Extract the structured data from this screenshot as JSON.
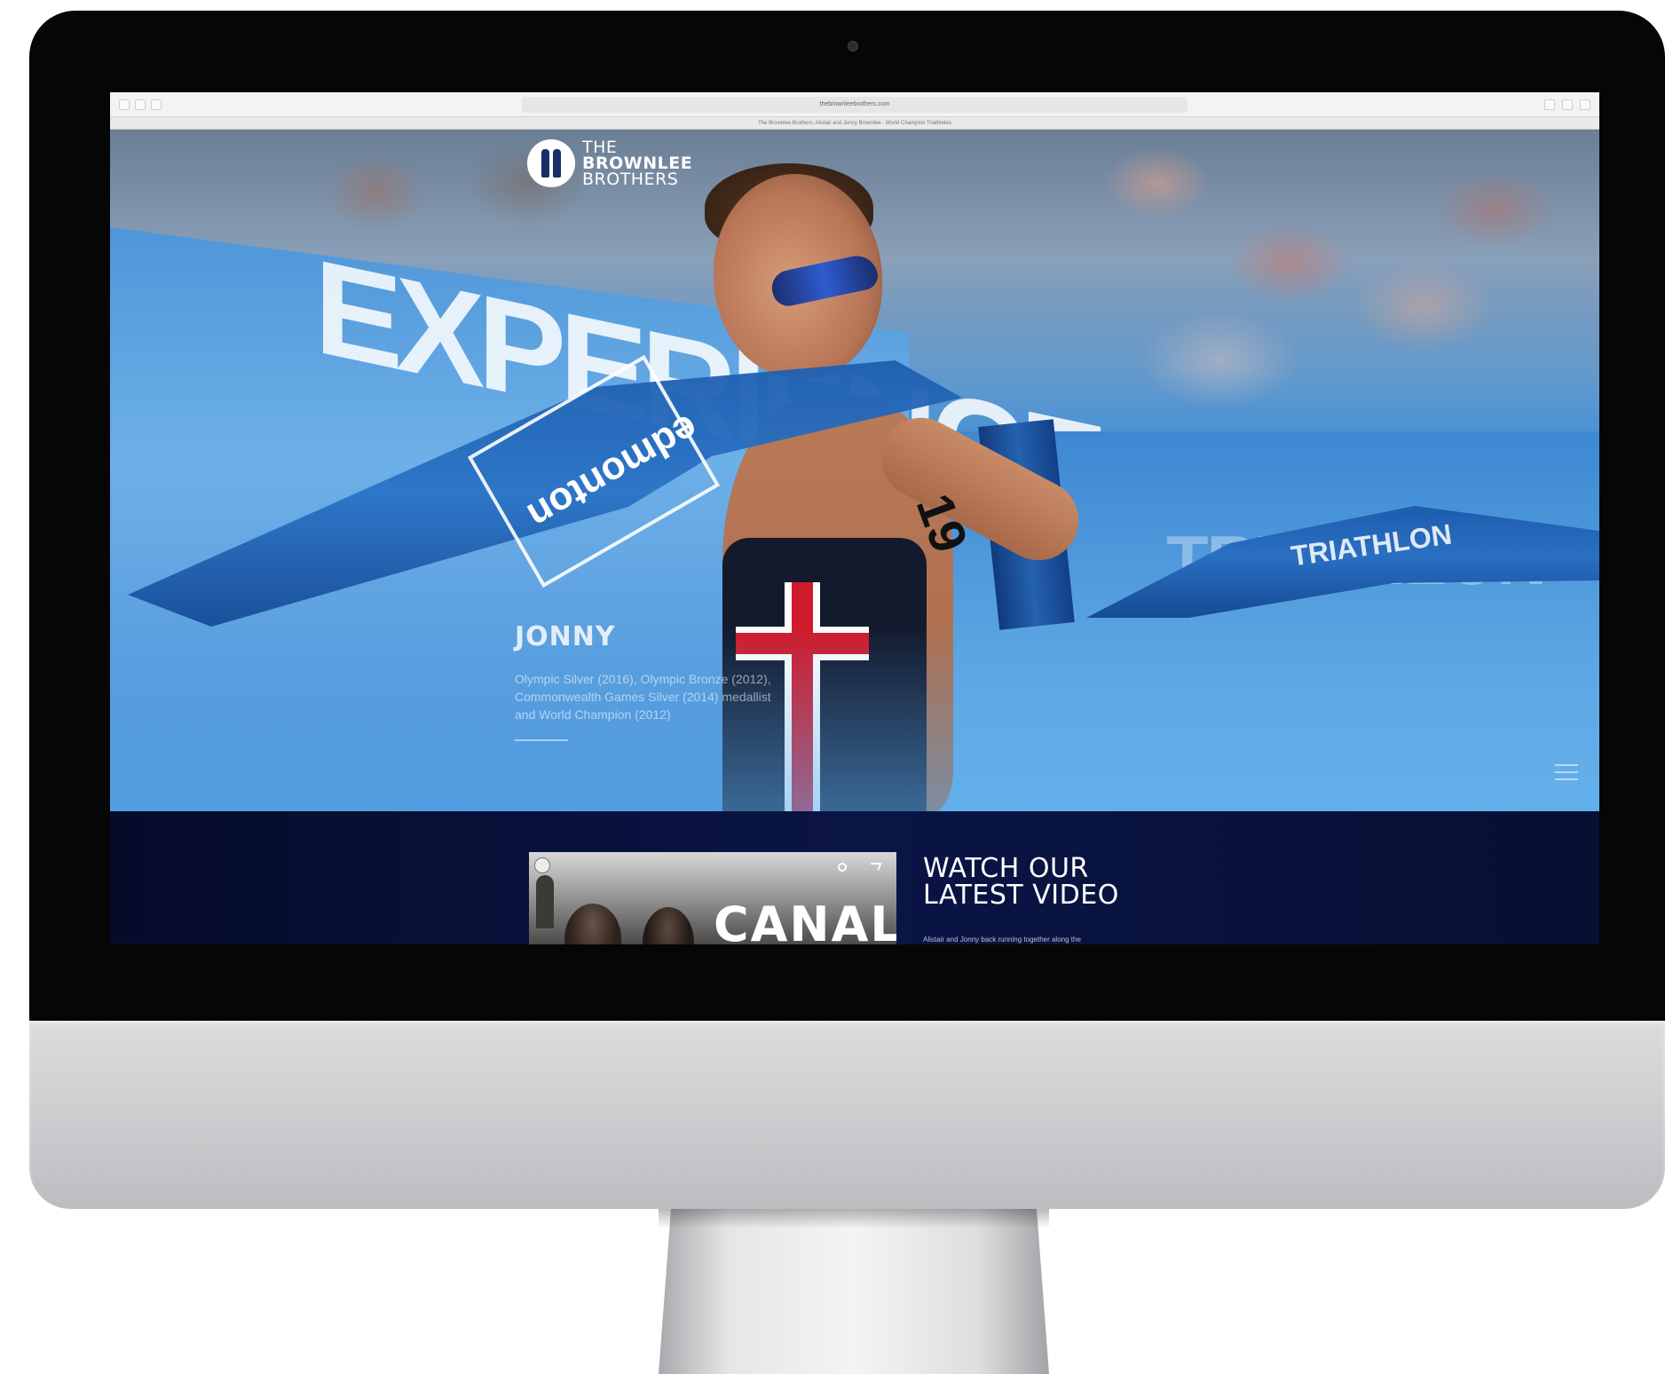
{
  "browser": {
    "url": "thebrownleebrothers.com",
    "tab_title": "The Brownlee Brothers: Alistair and Jonny Brownlee - World Champion Triathletes"
  },
  "site": {
    "logo_lines": [
      "THE",
      "BROWNLEE",
      "BROTHERS"
    ]
  },
  "hero": {
    "banner_text": "EXPERIENCE",
    "fence_text": "TRIATHLON",
    "tape_logo": "edmonton",
    "tape_text": "TRIATHLON",
    "arm_number": "19",
    "caption_name": "JONNY",
    "caption_text": "Olympic Silver (2016), Olympic Bronze (2012), Commonwealth Games Silver (2014) medallist and World Champion (2012)"
  },
  "video": {
    "thumbnail_title": "CANAL",
    "heading_line1": "WATCH OUR",
    "heading_line2": "LATEST VIDEO",
    "description": "Alistair and Jonny back running together along the"
  },
  "colors": {
    "navy": "#0b1546",
    "hero_blue": "#3a86d0",
    "flag_red": "#cf1b2b"
  }
}
